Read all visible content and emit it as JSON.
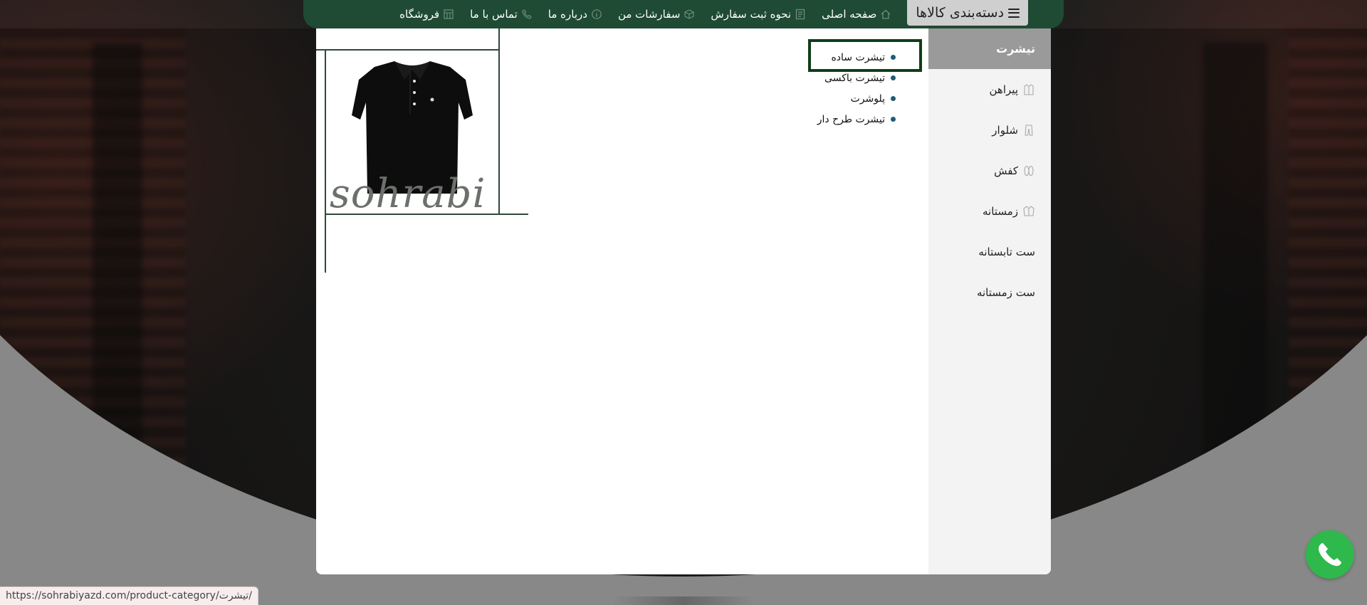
{
  "topnav": {
    "categories_label": "دسته‌بندی کالاها",
    "items": [
      {
        "label": "صفحه اصلی",
        "icon": "home-icon"
      },
      {
        "label": "نحوه ثبت سفارش",
        "icon": "document-icon"
      },
      {
        "label": "سفارشات من",
        "icon": "box-icon"
      },
      {
        "label": "درباره ما",
        "icon": "info-icon"
      },
      {
        "label": "تماس با ما",
        "icon": "phone-icon"
      },
      {
        "label": "فروشگاه",
        "icon": "store-icon"
      }
    ]
  },
  "mega_menu": {
    "side_items": [
      {
        "label": "تیشرت",
        "icon": "",
        "active": true
      },
      {
        "label": "پیراهن",
        "icon": "shirt-icon",
        "active": false
      },
      {
        "label": "شلوار",
        "icon": "pants-icon",
        "active": false
      },
      {
        "label": "کفش",
        "icon": "shoes-icon",
        "active": false
      },
      {
        "label": "زمستانه",
        "icon": "jacket-icon",
        "active": false
      },
      {
        "label": "ست تابستانه",
        "icon": "",
        "active": false
      },
      {
        "label": "ست زمستانه",
        "icon": "",
        "active": false
      }
    ],
    "sub_items": [
      "تیشرت ساده",
      "تیشرت باکسی",
      "پلوشرت",
      "تیشرت طرح دار"
    ],
    "brand_signature": "sohrabi"
  },
  "status_url": "https://sohrabiyazd.com/product-category/تیشرت/",
  "colors": {
    "nav_bg": "#1f4a34",
    "active_side": "#9a9a9a",
    "bullet": "#1f5a78",
    "whatsapp": "#2fb84b"
  }
}
